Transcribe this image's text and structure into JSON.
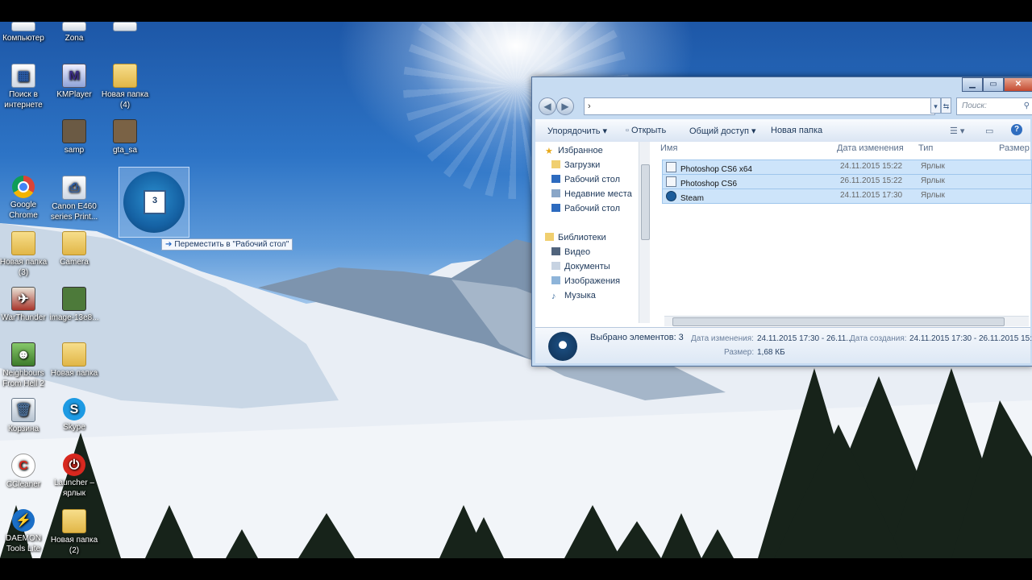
{
  "desktop": {
    "icons": [
      {
        "label": "Компьютер",
        "kind": "computer-icon"
      },
      {
        "label": "Zona",
        "kind": "zona-icon"
      },
      {
        "label": "Поиск в интернете",
        "kind": "search-internet-icon"
      },
      {
        "label": "KMPlayer",
        "kind": "kmplayer-icon"
      },
      {
        "label": "Новая папка (4)",
        "kind": "folder-icon"
      },
      {
        "label": "samp",
        "kind": "samp-icon"
      },
      {
        "label": "gta_sa",
        "kind": "gta-icon"
      },
      {
        "label": "Google Chrome",
        "kind": "chrome-icon"
      },
      {
        "label": "Canon E460 series Print...",
        "kind": "printer-icon"
      },
      {
        "label": "Новая папка (3)",
        "kind": "folder-icon"
      },
      {
        "label": "Camera",
        "kind": "folder-icon"
      },
      {
        "label": "WarThunder",
        "kind": "warthunder-icon"
      },
      {
        "label": "image-13e8...",
        "kind": "image-icon"
      },
      {
        "label": "Neighbours From Hell 2",
        "kind": "game-icon"
      },
      {
        "label": "Новая папка",
        "kind": "folder-icon"
      },
      {
        "label": "Корзина",
        "kind": "recycle-bin-icon"
      },
      {
        "label": "Skype",
        "kind": "skype-icon"
      },
      {
        "label": "CCleaner",
        "kind": "ccleaner-icon"
      },
      {
        "label": "Launcher – ярлык",
        "kind": "launcher-icon"
      },
      {
        "label": "DAEMON Tools Lite",
        "kind": "daemon-tools-icon"
      },
      {
        "label": "Новая папка (2)",
        "kind": "folder-icon"
      }
    ],
    "drag_badge": "3",
    "drag_tooltip": "Переместить в \"Рабочий стол\""
  },
  "explorer": {
    "address_arrow": "›",
    "search_placeholder": "Поиск:",
    "commands": {
      "organize": "Упорядочить ▾",
      "open": "Открыть",
      "share": "Общий доступ ▾",
      "new_folder": "Новая папка"
    },
    "nav": {
      "favorites": "Избранное",
      "downloads": "Загрузки",
      "desktop": "Рабочий стол",
      "recent": "Недавние места",
      "desktop2": "Рабочий стол",
      "libraries": "Библиотеки",
      "video": "Видео",
      "documents": "Документы",
      "images": "Изображения",
      "music": "Музыка"
    },
    "columns": {
      "name": "Имя",
      "date": "Дата изменения",
      "type": "Тип",
      "size": "Размер"
    },
    "files": [
      {
        "name": "Photoshop CS6 x64",
        "date": "24.11.2015 15:22",
        "type": "Ярлык"
      },
      {
        "name": "Photoshop CS6",
        "date": "26.11.2015 15:22",
        "type": "Ярлык"
      },
      {
        "name": "Steam",
        "date": "24.11.2015 17:30",
        "type": "Ярлык"
      }
    ],
    "details": {
      "selected": "Выбрано элементов: 3",
      "modified_label": "Дата изменения:",
      "modified_value": "24.11.2015 17:30 - 26.11...",
      "created_label": "Дата создания:",
      "created_value": "24.11.2015 17:30 - 26.11.2015 15:2",
      "size_label": "Размер:",
      "size_value": "1,68 КБ"
    }
  }
}
